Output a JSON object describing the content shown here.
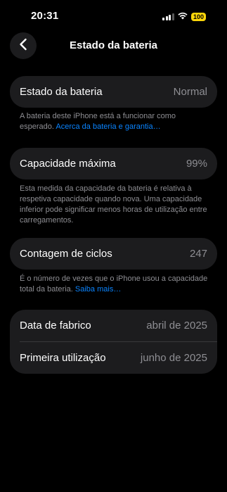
{
  "status_bar": {
    "time": "20:31",
    "battery_level": "100",
    "icons": [
      "signal-icon",
      "wifi-icon",
      "battery-icon"
    ],
    "battery_color": "#ffd60a"
  },
  "nav": {
    "title": "Estado da bateria",
    "back_icon": "chevron-left-icon"
  },
  "battery_health": {
    "label": "Estado da bateria",
    "value": "Normal",
    "footnote_text": "A bateria deste iPhone está a funcionar como esperado.",
    "footnote_link": "Acerca da bateria e garantia…"
  },
  "max_capacity": {
    "label": "Capacidade máxima",
    "value": "99%",
    "footnote_text": "Esta medida da capacidade da bateria é relativa à respetiva capacidade quando nova. Uma capacidade inferior pode significar menos horas de utilização entre carregamentos."
  },
  "cycle_count": {
    "label": "Contagem de ciclos",
    "value": "247",
    "footnote_text": "É o número de vezes que o iPhone usou a capacidade total da bateria.",
    "footnote_link": "Saiba mais…"
  },
  "dates": {
    "manufacture_label": "Data de fabrico",
    "manufacture_value": "abril de 2025",
    "first_use_label": "Primeira utilização",
    "first_use_value": "junho de 2025"
  },
  "colors": {
    "background": "#000000",
    "card": "#1c1c1e",
    "secondary_text": "#8e8e93",
    "link": "#0a84ff"
  }
}
